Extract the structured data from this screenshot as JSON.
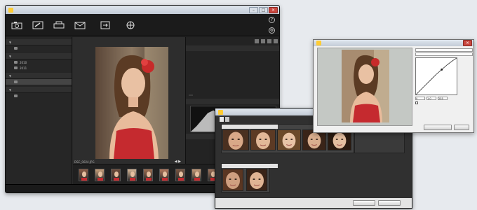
{
  "colors": {
    "app_bg": "#2a2a2a",
    "page_bg": "#e7eaee",
    "title_bar": "#c3ccd7",
    "close_red": "#c9473f"
  },
  "main_window": {
    "toolbar": {
      "items": [
        {
          "icon": "import-icon",
          "label": ""
        },
        {
          "icon": "edit-icon",
          "label": ""
        },
        {
          "icon": "print-icon",
          "label": ""
        },
        {
          "icon": "mail-icon",
          "label": ""
        },
        {
          "icon": "nikon-transfer-icon",
          "label": ""
        },
        {
          "icon": "web-icon",
          "label": ""
        }
      ],
      "help_icon": "?",
      "settings_icon": "gear-icon"
    },
    "sidebar": {
      "sections": [
        {
          "label": "",
          "items": [
            {
              "label": ""
            }
          ]
        },
        {
          "label": "",
          "items": [
            {
              "label": "2010"
            },
            {
              "label": "2011"
            }
          ]
        },
        {
          "label": "",
          "items": [
            {
              "label": ""
            }
          ]
        },
        {
          "label": "",
          "items": [
            {
              "label": ""
            }
          ]
        }
      ],
      "status": ""
    },
    "viewer": {
      "title": "",
      "filename": "DSC_0024.JPG",
      "arrows": "◀ ▶"
    },
    "right_panel": {
      "info_header": "",
      "info_rows": [
        {
          "k": "",
          "v": ""
        },
        {
          "k": "",
          "v": ""
        },
        {
          "k": "",
          "v": ""
        },
        {
          "k": "",
          "v": ""
        },
        {
          "k": "",
          "v": ""
        },
        {
          "k": "",
          "v": ""
        },
        {
          "k": "",
          "v": ""
        }
      ],
      "tab_label": "",
      "hist_header": "",
      "lower_header": ""
    },
    "filmstrip_label": "",
    "thumb_count": 11
  },
  "face_dialog": {
    "title": "",
    "tabs": [
      "",
      ""
    ],
    "group1_header": "",
    "group2_header": "",
    "buttons": {
      "edit": "",
      "ok": ""
    }
  },
  "edit_dialog": {
    "title": "",
    "channel": "",
    "checkbox_label": "",
    "values": {
      "a": "0",
      "b": "1.0",
      "c": "255"
    },
    "buttons": {
      "reset": "",
      "ok": ""
    }
  }
}
